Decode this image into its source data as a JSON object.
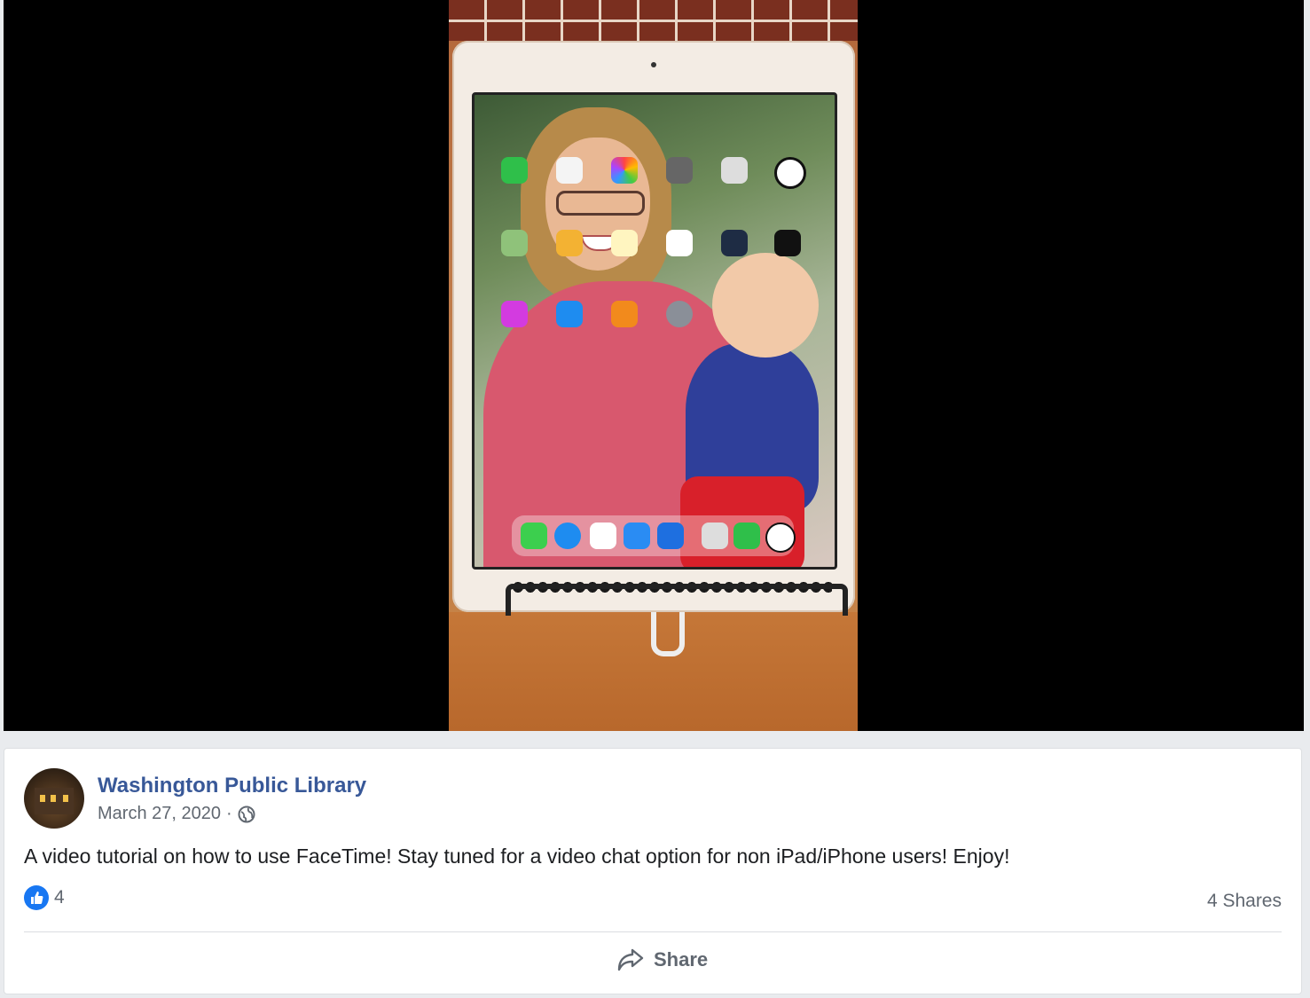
{
  "post": {
    "page_name": "Washington Public Library",
    "date": "March 27, 2020",
    "separator": "·",
    "text": "A video tutorial on how to use FaceTime! Stay tuned for a video chat option for non iPad/iPhone users! Enjoy!",
    "like_count": "4",
    "shares": "4 Shares",
    "share_label": "Share"
  },
  "colors": {
    "link": "#385898",
    "like": "#1877f2",
    "muted": "#606770"
  }
}
